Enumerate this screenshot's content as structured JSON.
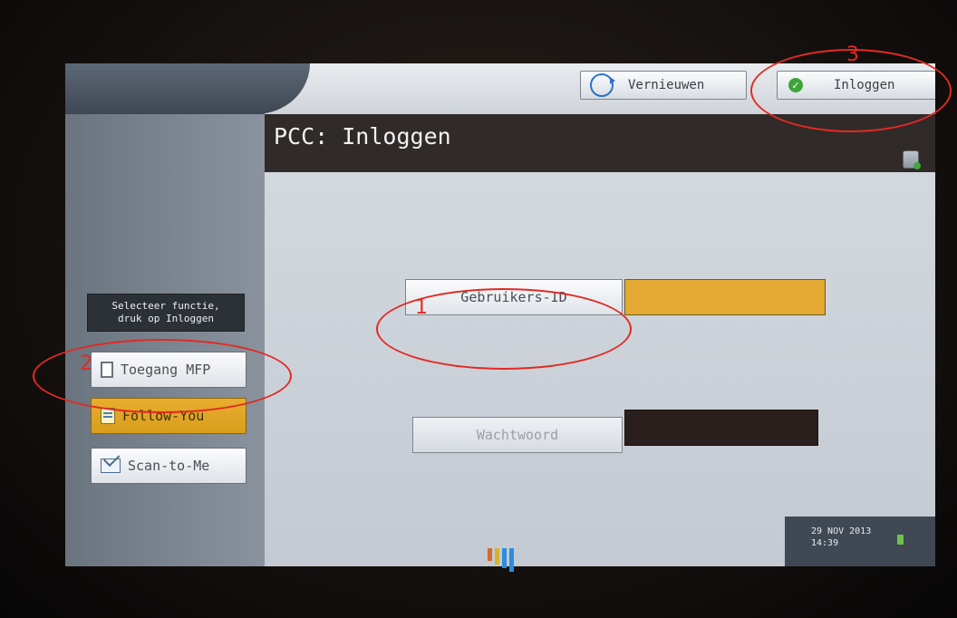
{
  "topbar": {
    "refresh_label": "Vernieuwen",
    "login_label": "Inloggen"
  },
  "title": "PCC: Inloggen",
  "sidebar": {
    "hint": "Selecteer functie,\ndruk op Inloggen",
    "items": [
      {
        "label": "Toegang MFP",
        "icon": "document-icon",
        "selected": false
      },
      {
        "label": "Follow-You",
        "icon": "note-icon",
        "selected": true
      },
      {
        "label": "Scan-to-Me",
        "icon": "mail-icon",
        "selected": false
      }
    ]
  },
  "form": {
    "user_id_label": "Gebruikers-ID",
    "user_id_value": "",
    "password_label": "Wachtwoord",
    "password_value": ""
  },
  "status": {
    "date": "29 NOV  2013",
    "time": "14:39"
  },
  "annotations": [
    "1",
    "2",
    "3"
  ],
  "colors": {
    "selected": "#e4a933",
    "title_bar": "#302a28",
    "annotation": "#e22a24"
  }
}
